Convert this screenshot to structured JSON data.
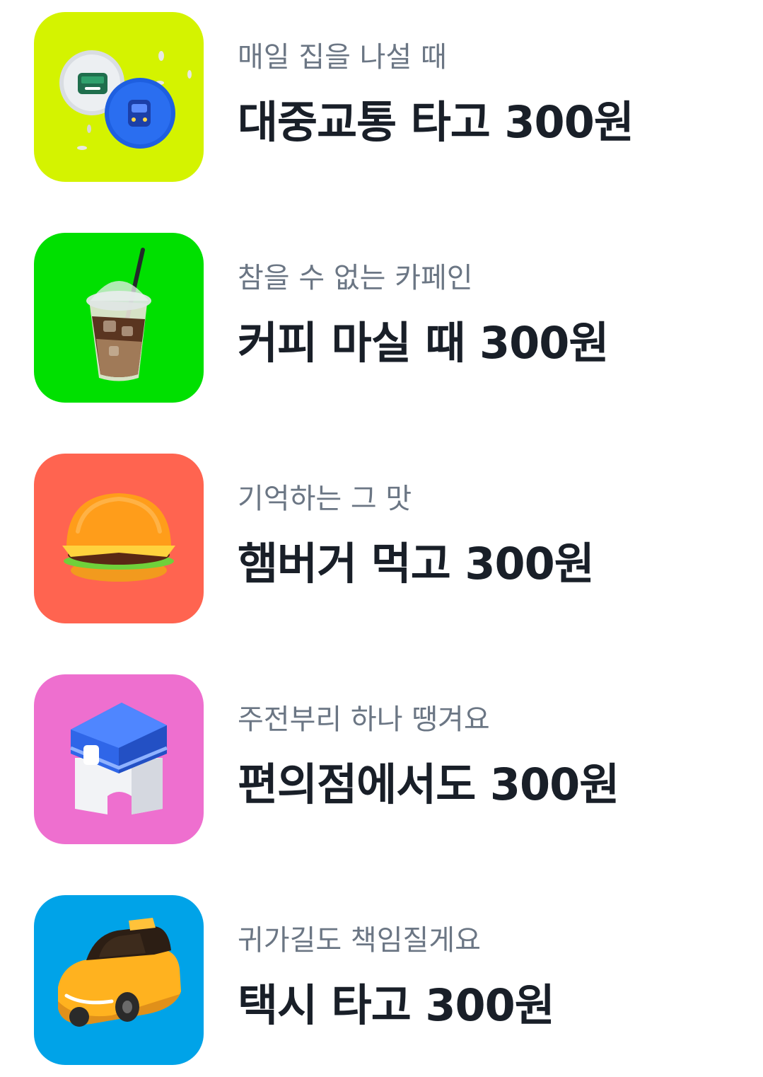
{
  "items": [
    {
      "subtitle": "매일 집을 나설 때",
      "title": "대중교통 타고 300원",
      "icon": "transit-icon",
      "tile_color": "#d4f300"
    },
    {
      "subtitle": "참을 수 없는 카페인",
      "title": "커피 마실 때 300원",
      "icon": "iced-coffee-icon",
      "tile_color": "#00e000"
    },
    {
      "subtitle": "기억하는 그 맛",
      "title": "햄버거 먹고 300원",
      "icon": "hamburger-icon",
      "tile_color": "#ff6450"
    },
    {
      "subtitle": "주전부리 하나 땡겨요",
      "title": "편의점에서도 300원",
      "icon": "convenience-store-icon",
      "tile_color": "#ee6fcf"
    },
    {
      "subtitle": "귀가길도 책임질게요",
      "title": "택시 타고 300원",
      "icon": "taxi-icon",
      "tile_color": "#00a3e8"
    }
  ]
}
